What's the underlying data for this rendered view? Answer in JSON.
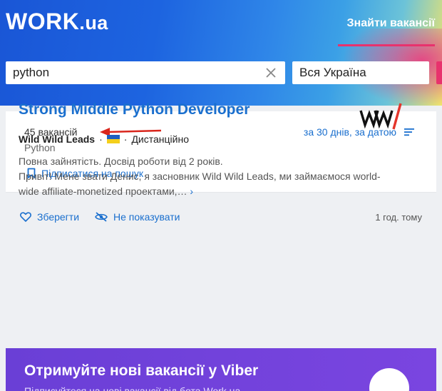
{
  "header": {
    "logo_main": "WORK",
    "logo_suffix": ".ua",
    "nav_link": "Знайти вакансії"
  },
  "search": {
    "query": "python",
    "region": "Вся Україна"
  },
  "results": {
    "count_text": "45 вакансій",
    "query_label": "Python",
    "sort_label": "за 30 днів, за датою",
    "subscribe_label": "Підписатися на пошук"
  },
  "job": {
    "title": "Strong Middle Python Developer",
    "company": "Wild Wild Leads",
    "separator": "·",
    "work_mode": "Дистанційно",
    "desc_line1": "Повна зайнятість. Досвід роботи від 2 років.",
    "desc_line2": "Привіт! Мене звати Денис, я засновник Wild Wild Leads, ми займаємося world-",
    "desc_line3": "wide affiliate-monetized проектами,…",
    "more_glyph": "›",
    "save_label": "Зберегти",
    "hide_label": "Не показувати",
    "posted": "1 год. тому"
  },
  "viber": {
    "title": "Отримуйте нові вакансії у Viber",
    "subtitle": "Підписуйтеся на нові вакансії від бота Work.ua"
  },
  "colors": {
    "link": "#1a6fce",
    "accent": "#e8326d",
    "viber": "#6a3fd6"
  }
}
